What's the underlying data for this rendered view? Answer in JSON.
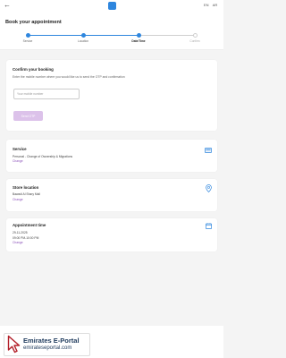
{
  "top_bar": {
    "back_icon": "arrow-left-icon",
    "logo_icon": "app-logo-icon",
    "languages": [
      "EN",
      "AR"
    ]
  },
  "page_title": "Book your appointment",
  "steps": [
    {
      "label": "Service",
      "state": "completed"
    },
    {
      "label": "Location",
      "state": "completed"
    },
    {
      "label": "Date/Time",
      "state": "current"
    },
    {
      "label": "Confirm",
      "state": "upcoming"
    }
  ],
  "confirm_booking": {
    "title": "Confirm your booking",
    "subtitle": "Enter the mobile number where you would like us to send the OTP and confirmation",
    "phone_placeholder": "Your mobile number",
    "phone_value": "",
    "send_button": "Send OTP"
  },
  "summary": {
    "service": {
      "title": "Service",
      "value": "Personal - Change of Ownership & Migrations",
      "change": "Change",
      "icon": "id-card-icon"
    },
    "location": {
      "title": "Store location",
      "value": "Bawadi Al Shary Mall",
      "change": "Change",
      "icon": "location-pin-icon"
    },
    "appointment": {
      "title": "Appointment time",
      "date": "29-11-2025",
      "time": "09:00 PM-10:00 PM",
      "change": "Change",
      "icon": "calendar-icon"
    }
  },
  "watermark": {
    "title": "Emirates E-Portal",
    "url": "emirateseportal.com",
    "icon": "cursor-arrow-icon"
  },
  "colors": {
    "accent": "#8a4fb8",
    "step_active": "#2e86de",
    "button_disabled": "#dcc2ea",
    "watermark_text": "#1e3a5c"
  }
}
